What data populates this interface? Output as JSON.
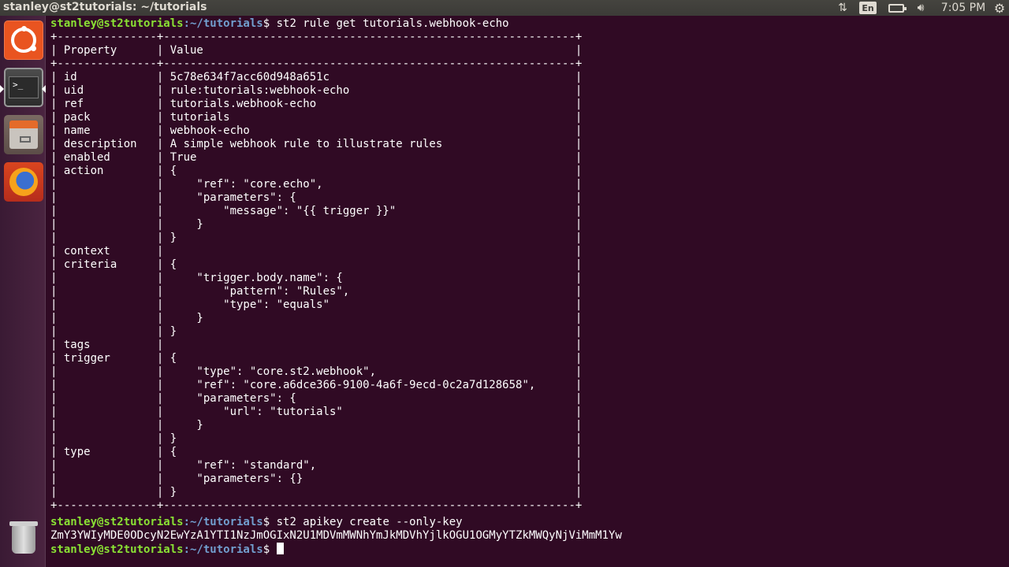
{
  "panel": {
    "window_title": "stanley@st2tutorials: ~/tutorials",
    "keyboard_layout": "En",
    "clock": "7:05 PM",
    "icons": [
      "network-arrows-icon",
      "battery-icon",
      "volume-icon",
      "gear-icon"
    ]
  },
  "launcher": {
    "items": [
      "ubuntu-dash-icon",
      "terminal-app-icon",
      "files-app-icon",
      "firefox-app-icon",
      "trash-icon"
    ],
    "terminal_glyph": ">_"
  },
  "terminal": {
    "prompt_user": "stanley@st2tutorials",
    "prompt_path": ":~/tutorials",
    "prompt_symbol": "$ ",
    "command1": "st2 rule get tutorials.webhook-echo",
    "table_lines": [
      "+---------------+--------------------------------------------------------------+",
      "| Property      | Value                                                        |",
      "+---------------+--------------------------------------------------------------+",
      "| id            | 5c78e634f7acc60d948a651c                                     |",
      "| uid           | rule:tutorials:webhook-echo                                  |",
      "| ref           | tutorials.webhook-echo                                       |",
      "| pack          | tutorials                                                    |",
      "| name          | webhook-echo                                                 |",
      "| description   | A simple webhook rule to illustrate rules                    |",
      "| enabled       | True                                                         |",
      "| action        | {                                                            |",
      "|               |     \"ref\": \"core.echo\",                                      |",
      "|               |     \"parameters\": {                                          |",
      "|               |         \"message\": \"{{ trigger }}\"                           |",
      "|               |     }                                                        |",
      "|               | }                                                            |",
      "| context       |                                                              |",
      "| criteria      | {                                                            |",
      "|               |     \"trigger.body.name\": {                                   |",
      "|               |         \"pattern\": \"Rules\",                                  |",
      "|               |         \"type\": \"equals\"                                     |",
      "|               |     }                                                        |",
      "|               | }                                                            |",
      "| tags          |                                                              |",
      "| trigger       | {                                                            |",
      "|               |     \"type\": \"core.st2.webhook\",                              |",
      "|               |     \"ref\": \"core.a6dce366-9100-4a6f-9ecd-0c2a7d128658\",      |",
      "|               |     \"parameters\": {                                          |",
      "|               |         \"url\": \"tutorials\"                                   |",
      "|               |     }                                                        |",
      "|               | }                                                            |",
      "| type          | {                                                            |",
      "|               |     \"ref\": \"standard\",                                       |",
      "|               |     \"parameters\": {}                                         |",
      "|               | }                                                            |",
      "+---------------+--------------------------------------------------------------+"
    ],
    "command2": "st2 apikey create --only-key",
    "apikey_output": "ZmY3YWIyMDE0ODcyN2EwYzA1YTI1NzJmOGIxN2U1MDVmMWNhYmJkMDVhYjlkOGU1OGMyYTZkMWQyNjViMmM1Yw"
  }
}
